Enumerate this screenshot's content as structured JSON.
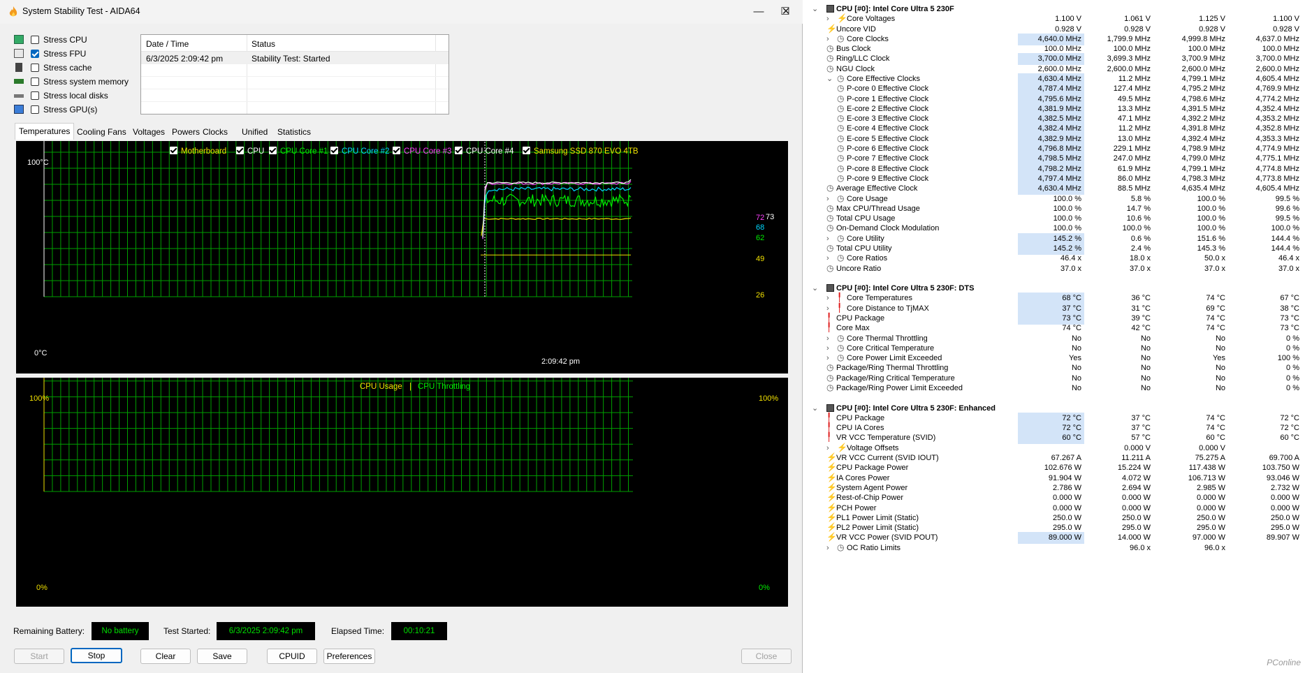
{
  "aida": {
    "title": "System Stability Test - AIDA64",
    "window_buttons": {
      "minimize": "—",
      "maximize": "☐",
      "close": "✕"
    },
    "stress_options": [
      {
        "label": "Stress CPU",
        "checked": false,
        "icon": "cpu-icon"
      },
      {
        "label": "Stress FPU",
        "checked": true,
        "icon": "fpu-icon"
      },
      {
        "label": "Stress cache",
        "checked": false,
        "icon": "cache-icon"
      },
      {
        "label": "Stress system memory",
        "checked": false,
        "icon": "memory-icon"
      },
      {
        "label": "Stress local disks",
        "checked": false,
        "icon": "disk-icon"
      },
      {
        "label": "Stress GPU(s)",
        "checked": false,
        "icon": "gpu-icon"
      }
    ],
    "status_table": {
      "headers": [
        "Date / Time",
        "Status"
      ],
      "rows": [
        [
          "6/3/2025 2:09:42 pm",
          "Stability Test: Started"
        ]
      ]
    },
    "tabs": [
      "Temperatures",
      "Cooling Fans",
      "Voltages",
      "Powers",
      "Clocks",
      "Unified",
      "Statistics"
    ],
    "active_tab": "Temperatures",
    "temp_graph": {
      "legend": [
        {
          "label": "Motherboard",
          "color": "#f0e000"
        },
        {
          "label": "CPU",
          "color": "#ffffff"
        },
        {
          "label": "CPU Core #1",
          "color": "#00ee00"
        },
        {
          "label": "CPU Core #2",
          "color": "#00d8ff"
        },
        {
          "label": "CPU Core #3",
          "color": "#ff40ff"
        },
        {
          "label": "CPU Core #4",
          "color": "#ffffff"
        },
        {
          "label": "Samsung SSD 870 EVO 4TB",
          "color": "#f0e000"
        }
      ],
      "y_max": "100°C",
      "y_min": "0°C",
      "time_label": "2:09:42 pm",
      "value_labels": [
        {
          "text": "72",
          "value": 72,
          "color": "#ff40ff"
        },
        {
          "text": "73",
          "value": 73,
          "color": "#ffffff"
        },
        {
          "text": "68",
          "value": 68,
          "color": "#00d8ff"
        },
        {
          "text": "62",
          "value": 62,
          "color": "#00ee00"
        },
        {
          "text": "49",
          "value": 49,
          "color": "#f0e000"
        },
        {
          "text": "26",
          "value": 26,
          "color": "#f0e000"
        }
      ]
    },
    "usage_graph": {
      "legend_usage": "CPU Usage",
      "legend_sep": "|",
      "legend_throttling": "CPU Throttling",
      "y_max_left": "100%",
      "y_min_left": "0%",
      "y_max_right": "100%",
      "y_min_right": "0%"
    },
    "footer": {
      "remaining_battery_label": "Remaining Battery:",
      "remaining_battery_value": "No battery",
      "test_started_label": "Test Started:",
      "test_started_value": "6/3/2025 2:09:42 pm",
      "elapsed_label": "Elapsed Time:",
      "elapsed_value": "00:10:21"
    },
    "buttons": {
      "start": "Start",
      "stop": "Stop",
      "clear": "Clear",
      "save": "Save",
      "cpuid": "CPUID",
      "preferences": "Preferences",
      "close": "Close"
    }
  },
  "hwinfo": {
    "rows": [
      {
        "type": "section",
        "name": "CPU [#0]: Intel Core Ultra 5 230F"
      },
      {
        "name": "Core Voltages",
        "icon": "bolt",
        "expand": true,
        "indent": 1,
        "v": [
          "1.100 V",
          "1.061 V",
          "1.125 V",
          "1.100 V"
        ]
      },
      {
        "name": "Uncore VID",
        "icon": "bolt",
        "v": [
          "0.928 V",
          "0.928 V",
          "0.928 V",
          "0.928 V"
        ]
      },
      {
        "name": "Core Clocks",
        "icon": "clock",
        "expand": true,
        "indent": 1,
        "hl": true,
        "v": [
          "4,640.0 MHz",
          "1,799.9 MHz",
          "4,999.8 MHz",
          "4,637.0 MHz"
        ]
      },
      {
        "name": "Bus Clock",
        "icon": "clock",
        "v": [
          "100.0 MHz",
          "100.0 MHz",
          "100.0 MHz",
          "100.0 MHz"
        ]
      },
      {
        "name": "Ring/LLC Clock",
        "icon": "clock",
        "hl": true,
        "v": [
          "3,700.0 MHz",
          "3,699.3 MHz",
          "3,700.9 MHz",
          "3,700.0 MHz"
        ]
      },
      {
        "name": "NGU Clock",
        "icon": "clock",
        "v": [
          "2,600.0 MHz",
          "2,600.0 MHz",
          "2,600.0 MHz",
          "2,600.0 MHz"
        ]
      },
      {
        "name": "Core Effective Clocks",
        "icon": "clock",
        "expanded": true,
        "indent": 1,
        "hl": true,
        "v": [
          "4,630.4 MHz",
          "11.2 MHz",
          "4,799.1 MHz",
          "4,605.4 MHz"
        ]
      },
      {
        "name": "P-core 0 Effective Clock",
        "icon": "clock",
        "indent": 2,
        "hl": true,
        "v": [
          "4,787.4 MHz",
          "127.4 MHz",
          "4,795.2 MHz",
          "4,769.9 MHz"
        ]
      },
      {
        "name": "P-core 1 Effective Clock",
        "icon": "clock",
        "indent": 2,
        "hl": true,
        "v": [
          "4,795.6 MHz",
          "49.5 MHz",
          "4,798.6 MHz",
          "4,774.2 MHz"
        ]
      },
      {
        "name": "E-core 2 Effective Clock",
        "icon": "clock",
        "indent": 2,
        "hl": true,
        "v": [
          "4,381.9 MHz",
          "13.3 MHz",
          "4,391.5 MHz",
          "4,352.4 MHz"
        ]
      },
      {
        "name": "E-core 3 Effective Clock",
        "icon": "clock",
        "indent": 2,
        "hl": true,
        "v": [
          "4,382.5 MHz",
          "47.1 MHz",
          "4,392.2 MHz",
          "4,353.2 MHz"
        ]
      },
      {
        "name": "E-core 4 Effective Clock",
        "icon": "clock",
        "indent": 2,
        "hl": true,
        "v": [
          "4,382.4 MHz",
          "11.2 MHz",
          "4,391.8 MHz",
          "4,352.8 MHz"
        ]
      },
      {
        "name": "E-core 5 Effective Clock",
        "icon": "clock",
        "indent": 2,
        "hl": true,
        "v": [
          "4,382.9 MHz",
          "13.0 MHz",
          "4,392.4 MHz",
          "4,353.3 MHz"
        ]
      },
      {
        "name": "P-core 6 Effective Clock",
        "icon": "clock",
        "indent": 2,
        "hl": true,
        "v": [
          "4,796.8 MHz",
          "229.1 MHz",
          "4,798.9 MHz",
          "4,774.9 MHz"
        ]
      },
      {
        "name": "P-core 7 Effective Clock",
        "icon": "clock",
        "indent": 2,
        "hl": true,
        "v": [
          "4,798.5 MHz",
          "247.0 MHz",
          "4,799.0 MHz",
          "4,775.1 MHz"
        ]
      },
      {
        "name": "P-core 8 Effective Clock",
        "icon": "clock",
        "indent": 2,
        "hl": true,
        "v": [
          "4,798.2 MHz",
          "61.9 MHz",
          "4,799.1 MHz",
          "4,774.8 MHz"
        ]
      },
      {
        "name": "P-core 9 Effective Clock",
        "icon": "clock",
        "indent": 2,
        "hl": true,
        "v": [
          "4,797.4 MHz",
          "86.0 MHz",
          "4,798.3 MHz",
          "4,773.8 MHz"
        ]
      },
      {
        "name": "Average Effective Clock",
        "icon": "clock",
        "hl": true,
        "v": [
          "4,630.4 MHz",
          "88.5 MHz",
          "4,635.4 MHz",
          "4,605.4 MHz"
        ]
      },
      {
        "name": "Core Usage",
        "icon": "clock",
        "expand": true,
        "indent": 1,
        "v": [
          "100.0 %",
          "5.8 %",
          "100.0 %",
          "99.5 %"
        ]
      },
      {
        "name": "Max CPU/Thread Usage",
        "icon": "clock",
        "v": [
          "100.0 %",
          "14.7 %",
          "100.0 %",
          "99.6 %"
        ]
      },
      {
        "name": "Total CPU Usage",
        "icon": "clock",
        "v": [
          "100.0 %",
          "10.6 %",
          "100.0 %",
          "99.5 %"
        ]
      },
      {
        "name": "On-Demand Clock Modulation",
        "icon": "clock",
        "v": [
          "100.0 %",
          "100.0 %",
          "100.0 %",
          "100.0 %"
        ]
      },
      {
        "name": "Core Utility",
        "icon": "clock",
        "expand": true,
        "indent": 1,
        "hl": true,
        "v": [
          "145.2 %",
          "0.6 %",
          "151.6 %",
          "144.4 %"
        ]
      },
      {
        "name": "Total CPU Utility",
        "icon": "clock",
        "hl": true,
        "v": [
          "145.2 %",
          "2.4 %",
          "145.3 %",
          "144.4 %"
        ]
      },
      {
        "name": "Core Ratios",
        "icon": "clock",
        "expand": true,
        "indent": 1,
        "v": [
          "46.4 x",
          "18.0 x",
          "50.0 x",
          "46.4 x"
        ]
      },
      {
        "name": "Uncore Ratio",
        "icon": "clock",
        "v": [
          "37.0 x",
          "37.0 x",
          "37.0 x",
          "37.0 x"
        ]
      },
      {
        "type": "blank"
      },
      {
        "type": "section",
        "name": "CPU [#0]: Intel Core Ultra 5 230F: DTS"
      },
      {
        "name": "Core Temperatures",
        "icon": "therm",
        "expand": true,
        "indent": 1,
        "hl": true,
        "v": [
          "68 °C",
          "36 °C",
          "74 °C",
          "67 °C"
        ]
      },
      {
        "name": "Core Distance to TjMAX",
        "icon": "therm",
        "expand": true,
        "indent": 1,
        "hl": true,
        "v": [
          "37 °C",
          "31 °C",
          "69 °C",
          "38 °C"
        ]
      },
      {
        "name": "CPU Package",
        "icon": "therm",
        "hl": true,
        "v": [
          "73 °C",
          "39 °C",
          "74 °C",
          "73 °C"
        ]
      },
      {
        "name": "Core Max",
        "icon": "therm",
        "v": [
          "74 °C",
          "42 °C",
          "74 °C",
          "73 °C"
        ]
      },
      {
        "name": "Core Thermal Throttling",
        "icon": "clock",
        "expand": true,
        "indent": 1,
        "v": [
          "No",
          "No",
          "No",
          "0 %"
        ]
      },
      {
        "name": "Core Critical Temperature",
        "icon": "clock",
        "expand": true,
        "indent": 1,
        "v": [
          "No",
          "No",
          "No",
          "0 %"
        ]
      },
      {
        "name": "Core Power Limit Exceeded",
        "icon": "clock",
        "expand": true,
        "indent": 1,
        "v": [
          "Yes",
          "No",
          "Yes",
          "100 %"
        ]
      },
      {
        "name": "Package/Ring Thermal Throttling",
        "icon": "clock",
        "v": [
          "No",
          "No",
          "No",
          "0 %"
        ]
      },
      {
        "name": "Package/Ring Critical Temperature",
        "icon": "clock",
        "v": [
          "No",
          "No",
          "No",
          "0 %"
        ]
      },
      {
        "name": "Package/Ring Power Limit Exceeded",
        "icon": "clock",
        "v": [
          "No",
          "No",
          "No",
          "0 %"
        ]
      },
      {
        "type": "blank"
      },
      {
        "type": "section",
        "name": "CPU [#0]: Intel Core Ultra 5 230F: Enhanced"
      },
      {
        "name": "CPU Package",
        "icon": "therm",
        "hl": true,
        "v": [
          "72 °C",
          "37 °C",
          "74 °C",
          "72 °C"
        ]
      },
      {
        "name": "CPU IA Cores",
        "icon": "therm",
        "hl": true,
        "v": [
          "72 °C",
          "37 °C",
          "74 °C",
          "72 °C"
        ]
      },
      {
        "name": "VR VCC Temperature (SVID)",
        "icon": "therm",
        "hl": true,
        "v": [
          "60 °C",
          "57 °C",
          "60 °C",
          "60 °C"
        ]
      },
      {
        "name": "Voltage Offsets",
        "icon": "bolt",
        "expand": true,
        "indent": 1,
        "v": [
          "",
          "0.000 V",
          "0.000 V",
          ""
        ]
      },
      {
        "name": "VR VCC Current (SVID IOUT)",
        "icon": "bolt",
        "v": [
          "67.267 A",
          "11.211 A",
          "75.275 A",
          "69.700 A"
        ]
      },
      {
        "name": "CPU Package Power",
        "icon": "bolt",
        "v": [
          "102.676 W",
          "15.224 W",
          "117.438 W",
          "103.750 W"
        ]
      },
      {
        "name": "IA Cores Power",
        "icon": "bolt",
        "v": [
          "91.904 W",
          "4.072 W",
          "106.713 W",
          "93.046 W"
        ]
      },
      {
        "name": "System Agent Power",
        "icon": "bolt",
        "v": [
          "2.786 W",
          "2.694 W",
          "2.985 W",
          "2.732 W"
        ]
      },
      {
        "name": "Rest-of-Chip Power",
        "icon": "bolt",
        "v": [
          "0.000 W",
          "0.000 W",
          "0.000 W",
          "0.000 W"
        ]
      },
      {
        "name": "PCH Power",
        "icon": "bolt",
        "v": [
          "0.000 W",
          "0.000 W",
          "0.000 W",
          "0.000 W"
        ]
      },
      {
        "name": "PL1 Power Limit (Static)",
        "icon": "bolt",
        "v": [
          "250.0 W",
          "250.0 W",
          "250.0 W",
          "250.0 W"
        ]
      },
      {
        "name": "PL2 Power Limit (Static)",
        "icon": "bolt",
        "v": [
          "295.0 W",
          "295.0 W",
          "295.0 W",
          "295.0 W"
        ]
      },
      {
        "name": "VR VCC Power (SVID POUT)",
        "icon": "bolt",
        "hl": true,
        "v": [
          "89.000 W",
          "14.000 W",
          "97.000 W",
          "89.907 W"
        ]
      },
      {
        "name": "OC Ratio Limits",
        "icon": "clock",
        "expand": true,
        "indent": 1,
        "v": [
          "",
          "96.0 x",
          "96.0 x",
          ""
        ]
      }
    ],
    "watermark": "PConline"
  },
  "colors": {
    "grid": "#00a000",
    "graph_bg": "#000000",
    "highlight": "#d3e4f8",
    "accent": "#0067c0"
  }
}
